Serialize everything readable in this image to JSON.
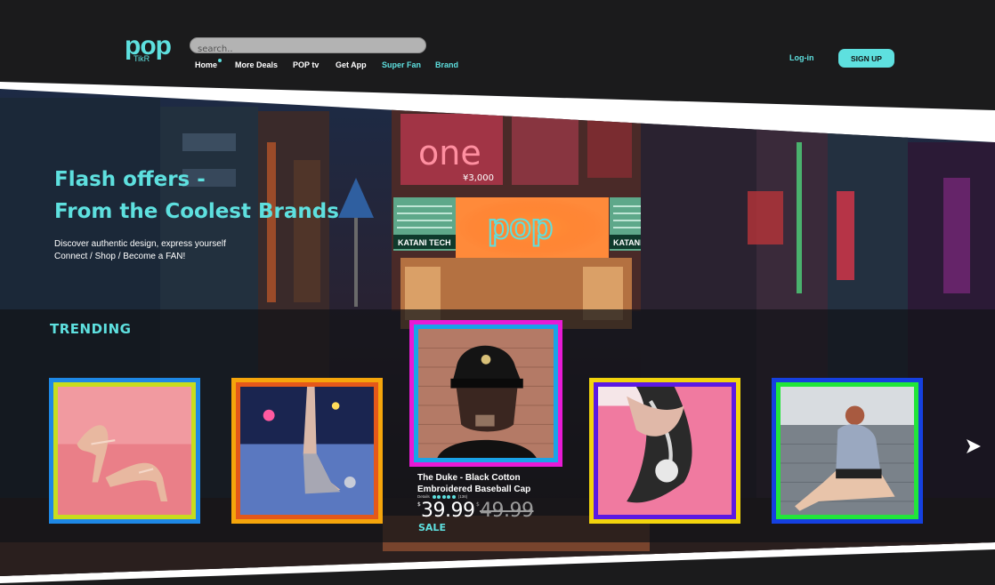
{
  "brand": {
    "logo_main": "pop",
    "logo_sub": "TikR"
  },
  "search": {
    "placeholder": "search.."
  },
  "nav": {
    "items": [
      {
        "label": "Home"
      },
      {
        "label": "More Deals"
      },
      {
        "label": "POP tv"
      },
      {
        "label": "Get App"
      },
      {
        "label": "Super Fan"
      },
      {
        "label": "Brand"
      }
    ]
  },
  "auth": {
    "login_label": "Log-in",
    "signup_label": "SIGN UP"
  },
  "hero": {
    "title_line1": "Flash offers -",
    "title_line2": "From the Coolest Brands",
    "subtitle_line1": "Discover authentic design, express yourself",
    "subtitle_line2": "Connect / Shop / Become a FAN!",
    "sign_main": "one",
    "sign_store_left": "KATANI TECH",
    "sign_store_right": "KATANI TECH",
    "sign_small": "¥3,000"
  },
  "trending": {
    "title": "TRENDING",
    "featured": {
      "name": "The Duke - Black Cotton Embroidered Baseball Cap",
      "rating_label": "Details",
      "rating_count": "(136)",
      "rating_stars": 5,
      "currency": "$",
      "price": "39.99",
      "old_price": "49.99",
      "badge": "SALE"
    }
  },
  "icons": {
    "next": "chevron-right-icon"
  },
  "colors": {
    "accent": "#5ee0df",
    "background": "#1b1b1c",
    "card1_outer": "#1e88e5",
    "card1_inner": "#c8dc1e",
    "card2_outer": "#f5a50b",
    "card2_inner": "#e4581a",
    "card3_outer": "#e81ad6",
    "card3_inner": "#1aa3e8",
    "card4_outer": "#f2d40d",
    "card4_inner": "#5b1ae3",
    "card5_outer": "#1540e0",
    "card5_inner": "#22e63a"
  }
}
